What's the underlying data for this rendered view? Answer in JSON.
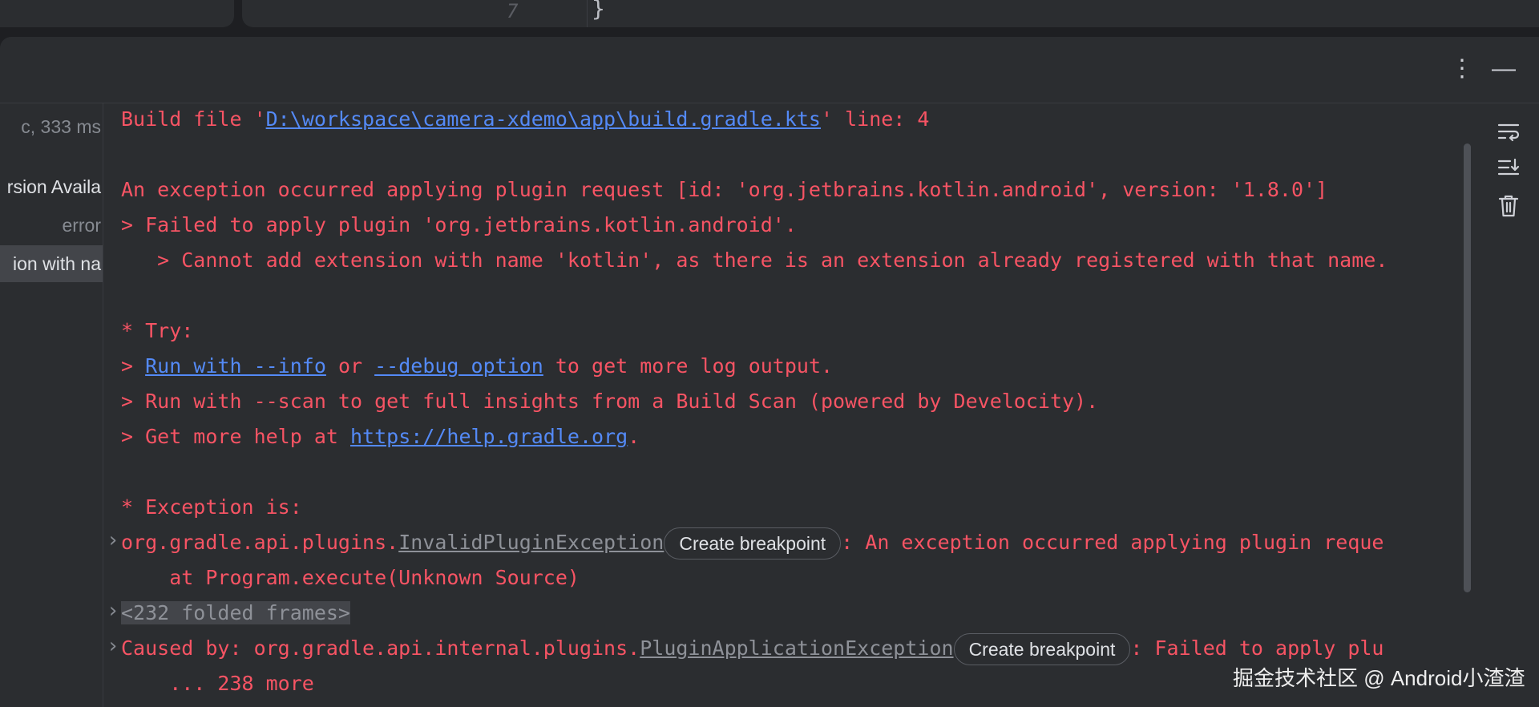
{
  "editor": {
    "line_number": "7",
    "code": "}"
  },
  "toolbar": {
    "more_icon": "⋮",
    "minimize_icon": "—"
  },
  "sidebar": {
    "items": [
      {
        "label": "c, 333 ms"
      },
      {
        "label": "rsion Availa"
      },
      {
        "label": "error"
      },
      {
        "label": "ion with na"
      }
    ]
  },
  "console": {
    "l1": {
      "prefix": "Build file '",
      "path": "D:\\workspace\\camera-xdemo\\app\\build.gradle.kts",
      "suffix": "' line: 4"
    },
    "l2": "An exception occurred applying plugin request [id: 'org.jetbrains.kotlin.android', version: '1.8.0']",
    "l3": "> Failed to apply plugin 'org.jetbrains.kotlin.android'.",
    "l4": "   > Cannot add extension with name 'kotlin', as there is an extension already registered with that name.",
    "l5": "* Try:",
    "l6": {
      "a": "> ",
      "link1": "Run with --info",
      "b": " or ",
      "link2": "--debug option",
      "c": " to get more log output."
    },
    "l7": "> Run with --scan to get full insights from a Build Scan (powered by Develocity).",
    "l8": {
      "a": "> Get more help at ",
      "link": "https://help.gradle.org",
      "b": "."
    },
    "l9": "* Exception is:",
    "l10": {
      "pkg": "org.gradle.api.plugins.",
      "cls": "InvalidPluginException",
      "chip": "Create breakpoint",
      "rest": ": An exception occurred applying plugin reque"
    },
    "l11": "    at Program.execute(Unknown Source)",
    "l12": "<232 folded frames>",
    "l13": {
      "pkg": "Caused by: org.gradle.api.internal.plugins.",
      "cls": "PluginApplicationException",
      "chip": "Create breakpoint",
      "rest": ": Failed to apply plu"
    },
    "l14": "    ... 238 more"
  },
  "watermark": "掘金技术社区 @ Android小渣渣",
  "colors": {
    "error": "#f75464",
    "link": "#548af7",
    "background": "#2b2d30"
  }
}
